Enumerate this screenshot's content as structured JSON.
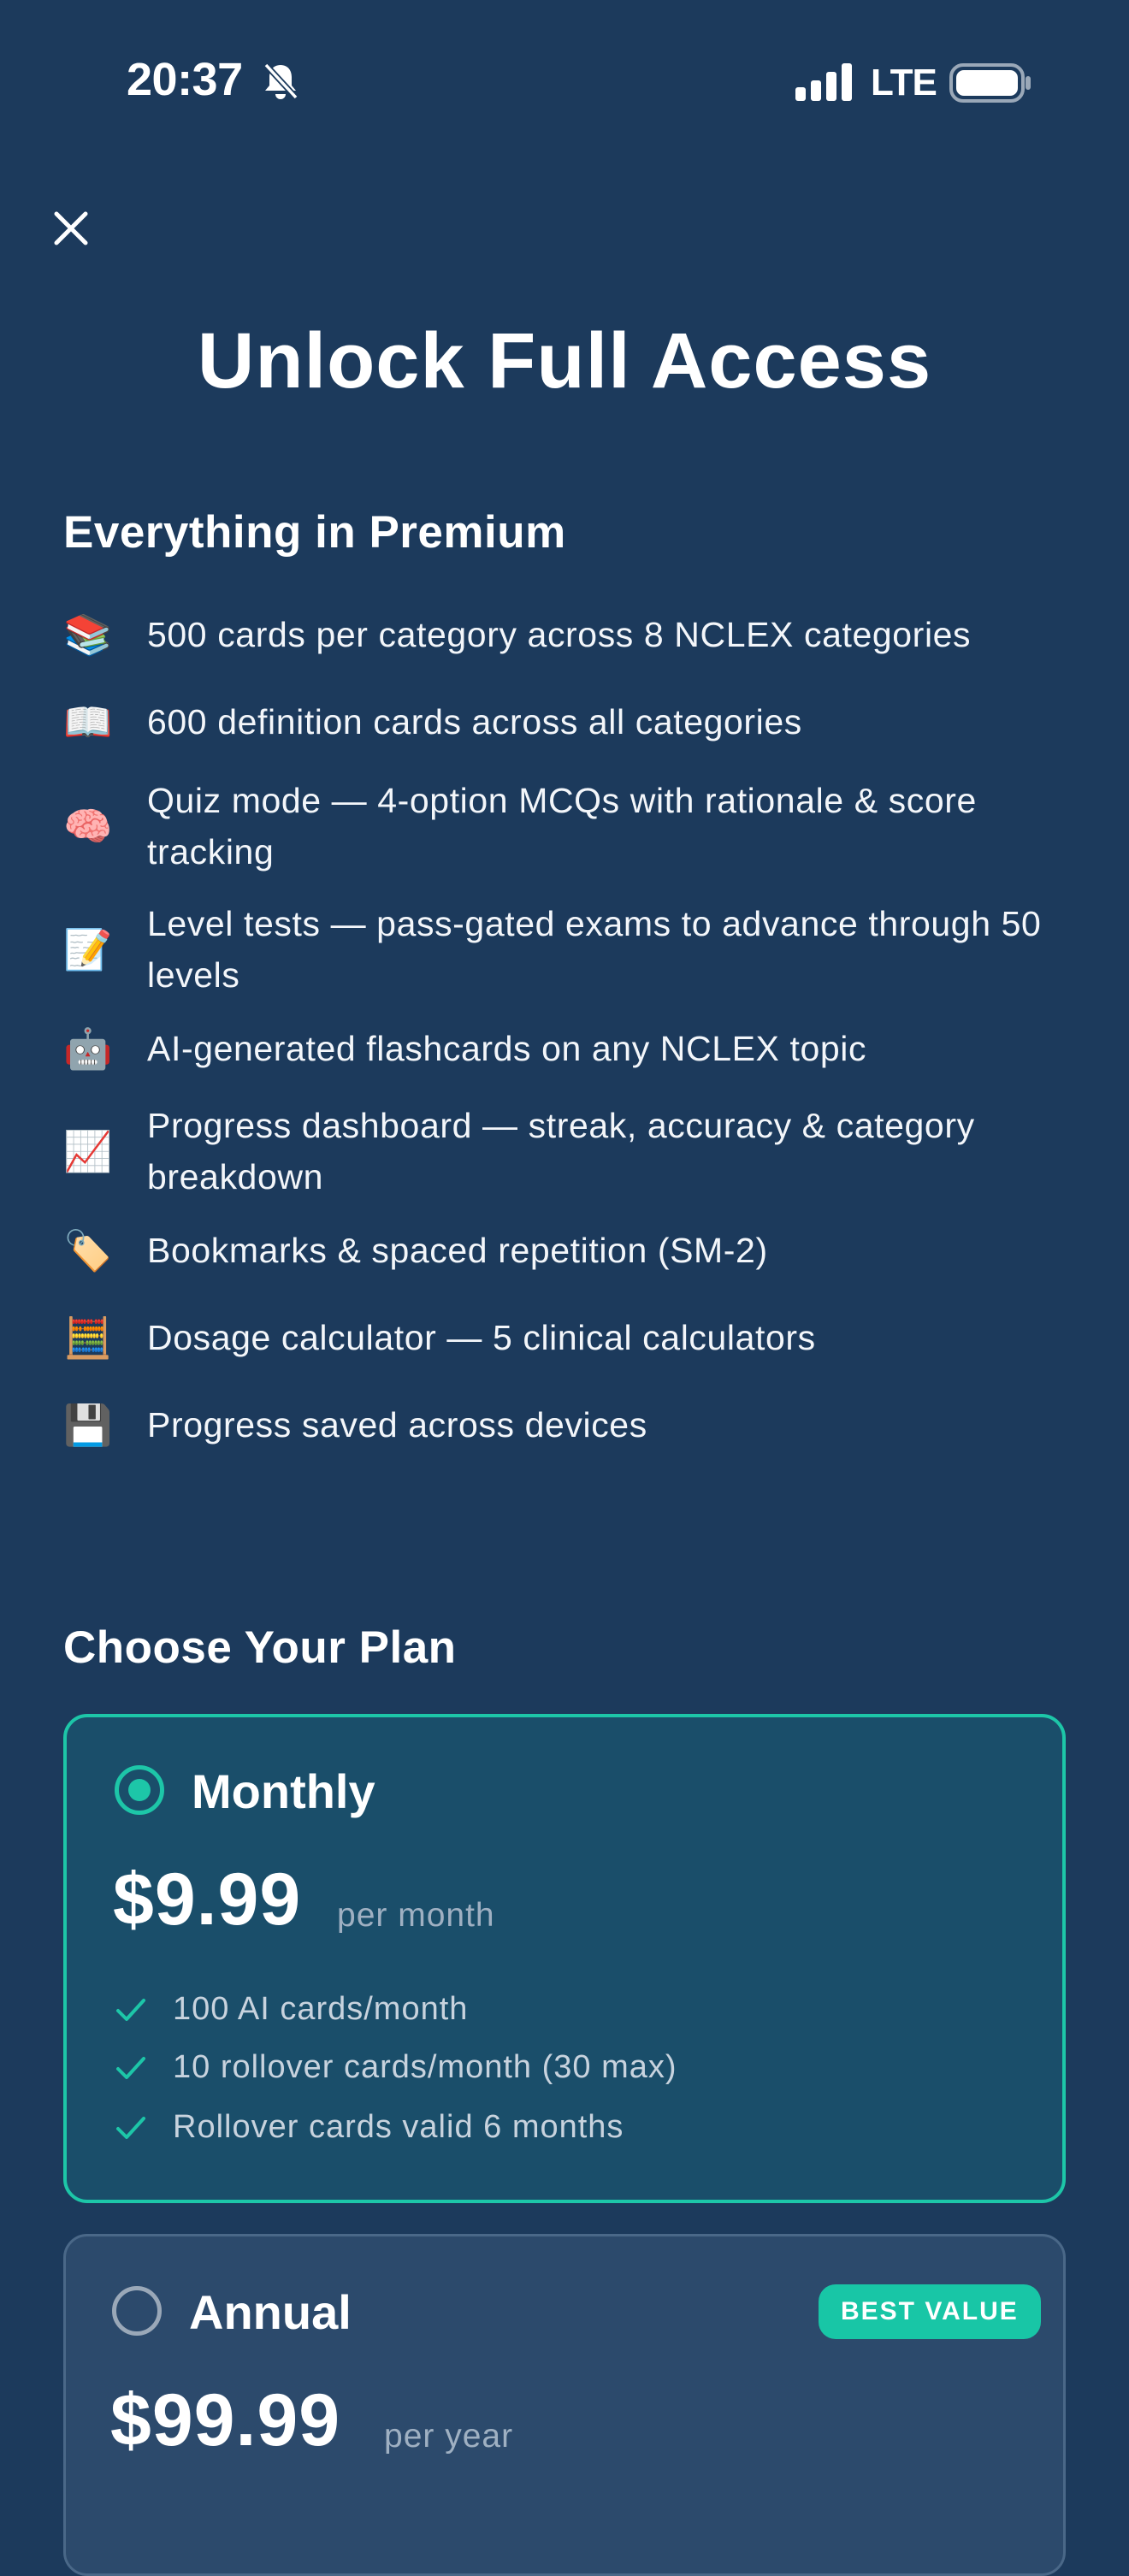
{
  "status": {
    "time": "20:37",
    "network": "LTE"
  },
  "icons": {
    "close": "close-icon",
    "bell": "bell-muted-icon",
    "signal": "signal-icon",
    "battery": "battery-icon",
    "check": "check-icon"
  },
  "title": "Unlock Full Access",
  "premium": {
    "heading": "Everything in Premium",
    "features": [
      {
        "emoji": "📚",
        "icon": "books-icon",
        "text": "500 cards per category across 8 NCLEX categories"
      },
      {
        "emoji": "📖",
        "icon": "open-book-icon",
        "text": "600 definition cards across all categories"
      },
      {
        "emoji": "🧠",
        "icon": "brain-icon",
        "text": "Quiz mode — 4-option MCQs with rationale & score tracking"
      },
      {
        "emoji": "📝",
        "icon": "memo-icon",
        "text": "Level tests — pass-gated exams to advance through 50 levels"
      },
      {
        "emoji": "🤖",
        "icon": "robot-icon",
        "text": "AI-generated flashcards on any NCLEX topic"
      },
      {
        "emoji": "📈",
        "icon": "chart-up-icon",
        "text": "Progress dashboard — streak, accuracy & category breakdown"
      },
      {
        "emoji": "🏷️",
        "icon": "tag-icon",
        "text": "Bookmarks & spaced repetition (SM-2)"
      },
      {
        "emoji": "🧮",
        "icon": "abacus-icon",
        "text": "Dosage calculator — 5 clinical calculators"
      },
      {
        "emoji": "💾",
        "icon": "floppy-disk-icon",
        "text": "Progress saved across devices"
      }
    ]
  },
  "plans": {
    "heading": "Choose Your Plan",
    "monthly": {
      "name": "Monthly",
      "price": "$9.99",
      "period": "per month",
      "selected": true,
      "perks": [
        "100 AI cards/month",
        "10 rollover cards/month (30 max)",
        "Rollover cards valid 6 months"
      ]
    },
    "annual": {
      "name": "Annual",
      "price": "$99.99",
      "period": "per year",
      "selected": false,
      "badge": "BEST VALUE"
    }
  },
  "colors": {
    "background": "#1c3a5c",
    "accent": "#1dc6a8",
    "selected_card": "#1a4e6a",
    "card": "#2c4a6c"
  }
}
